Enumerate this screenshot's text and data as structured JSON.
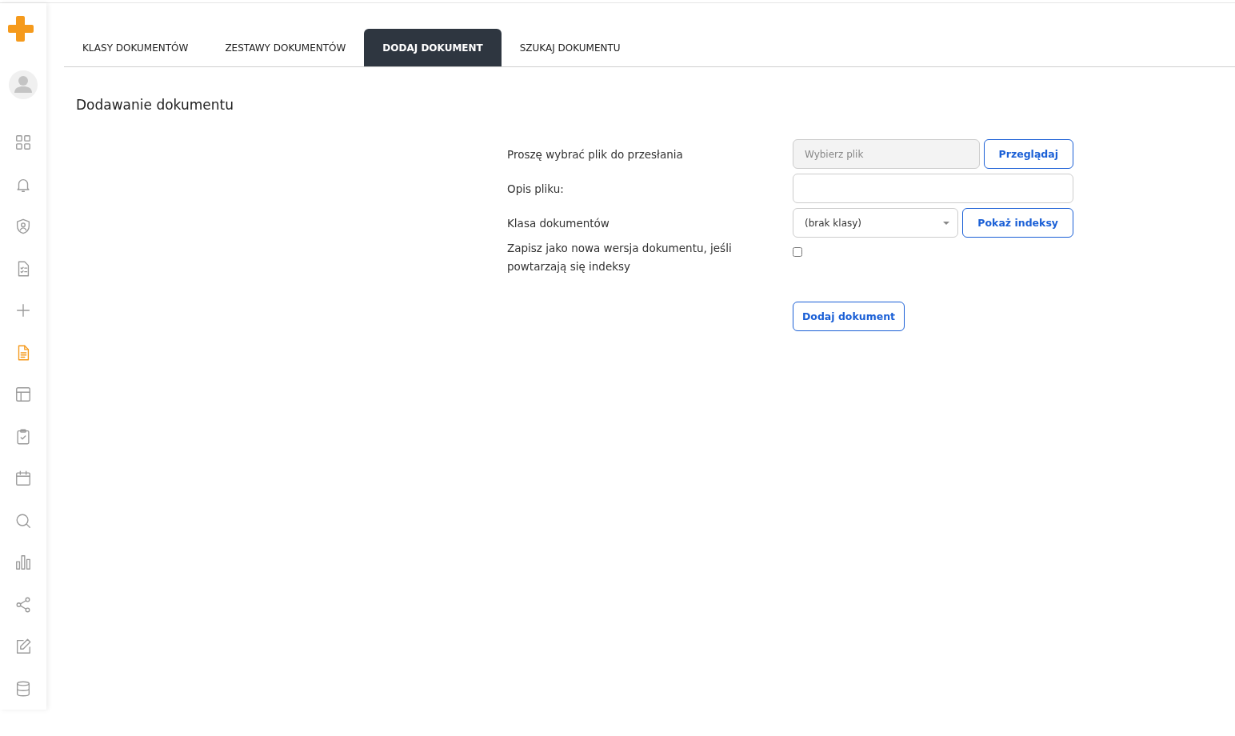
{
  "sidebar": {
    "items": [
      {
        "kind": "grid",
        "selected": false
      },
      {
        "kind": "bell",
        "selected": false
      },
      {
        "kind": "shield",
        "selected": false
      },
      {
        "kind": "checklist",
        "selected": false
      },
      {
        "kind": "plus",
        "selected": false
      },
      {
        "kind": "document",
        "selected": true
      },
      {
        "kind": "layout",
        "selected": false
      },
      {
        "kind": "clipboard",
        "selected": false
      },
      {
        "kind": "calendar",
        "selected": false
      },
      {
        "kind": "search",
        "selected": false
      },
      {
        "kind": "chart",
        "selected": false
      },
      {
        "kind": "share",
        "selected": false
      },
      {
        "kind": "edit",
        "selected": false
      },
      {
        "kind": "database",
        "selected": false
      }
    ]
  },
  "tabs": [
    {
      "label": "KLASY DOKUMENTÓW",
      "selected": false
    },
    {
      "label": "ZESTAWY DOKUMENTÓW",
      "selected": false
    },
    {
      "label": "DODAJ DOKUMENT",
      "selected": true
    },
    {
      "label": "SZUKAJ DOKUMENTU",
      "selected": false
    }
  ],
  "page_title": "Dodawanie dokumentu",
  "form": {
    "file_label": "Proszę wybrać plik do przesłania",
    "file_field": {
      "placeholder": "Wybierz plik"
    },
    "browse_button": "Przeglądaj",
    "description_label": "Opis pliku:",
    "class_label": "Klasa dokumentów",
    "class_select": {
      "value": "(brak klasy)"
    },
    "show_indexes_button": "Pokaż indeksy",
    "new_version_label": "Zapisz jako nowa wersja dokumentu, jeśli powtarzają się indeksy",
    "new_version_checked": false,
    "submit_button": "Dodaj dokument"
  }
}
